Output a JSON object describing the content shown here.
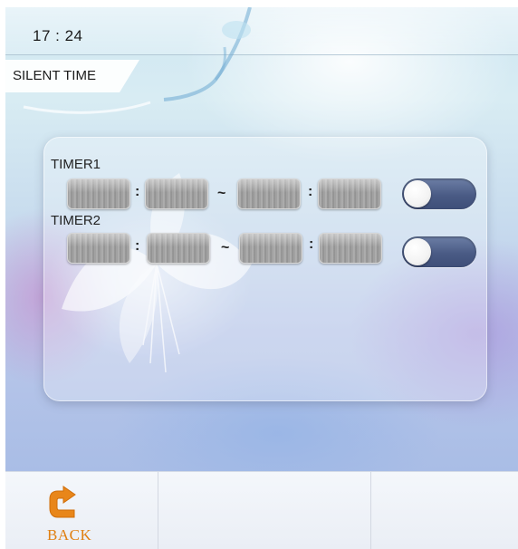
{
  "header": {
    "time": "17 : 24",
    "title": "SILENT TIME"
  },
  "timers": [
    {
      "label": "TIMER1",
      "start_separator": ":",
      "range_separator": "~",
      "end_separator": ":",
      "enabled": false
    },
    {
      "label": "TIMER2",
      "start_separator": ":",
      "range_separator": "~",
      "end_separator": ":",
      "enabled": false
    }
  ],
  "footer": {
    "back_label": "BACK",
    "back_icon": "back-arrow-icon"
  },
  "colors": {
    "accent": "#e08012",
    "toggle_off": "#4a5b85",
    "panel_text": "#222222"
  }
}
